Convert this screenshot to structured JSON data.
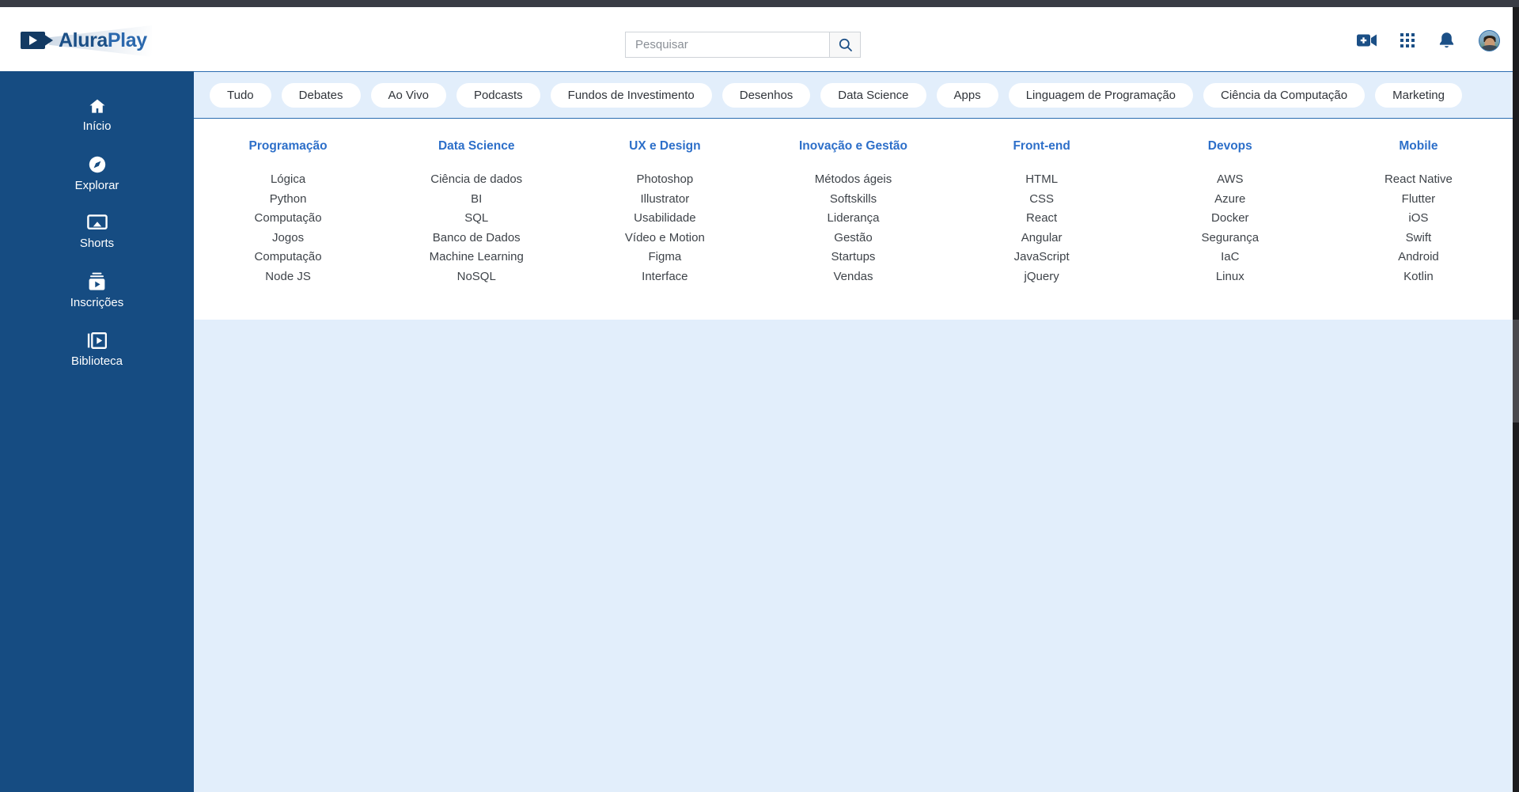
{
  "header": {
    "logo": {
      "text_primary": "Alura",
      "text_secondary": "Play",
      "icon": "video-camera-icon"
    },
    "search": {
      "placeholder": "Pesquisar",
      "value": "",
      "button_icon": "search-icon"
    },
    "actions": [
      {
        "name": "create-video-icon",
        "label": ""
      },
      {
        "name": "apps-grid-icon",
        "label": ""
      },
      {
        "name": "notifications-bell-icon",
        "label": ""
      },
      {
        "name": "user-avatar",
        "label": ""
      }
    ]
  },
  "sidebar": {
    "items": [
      {
        "label": "Início",
        "icon": "home-icon"
      },
      {
        "label": "Explorar",
        "icon": "compass-icon"
      },
      {
        "label": "Shorts",
        "icon": "shorts-screen-icon"
      },
      {
        "label": "Inscrições",
        "icon": "subscriptions-icon"
      },
      {
        "label": "Biblioteca",
        "icon": "library-icon"
      }
    ]
  },
  "chips": [
    "Tudo",
    "Debates",
    "Ao Vivo",
    "Podcasts",
    "Fundos de Investimento",
    "Desenhos",
    "Data Science",
    "Apps",
    "Linguagem de Programação",
    "Ciência da Computação",
    "Marketing"
  ],
  "categories": [
    {
      "title": "Programação",
      "links": [
        "Lógica",
        "Python",
        "Computação",
        "Jogos",
        "Computação",
        "Node JS"
      ]
    },
    {
      "title": "Data Science",
      "links": [
        "Ciência de dados",
        "BI",
        "SQL",
        "Banco de Dados",
        "Machine Learning",
        "NoSQL"
      ]
    },
    {
      "title": "UX e Design",
      "links": [
        "Photoshop",
        "Illustrator",
        "Usabilidade",
        "Vídeo e Motion",
        "Figma",
        "Interface"
      ]
    },
    {
      "title": "Inovação e Gestão",
      "links": [
        "Métodos ágeis",
        "Softskills",
        "Liderança",
        "Gestão",
        "Startups",
        "Vendas"
      ]
    },
    {
      "title": "Front-end",
      "links": [
        "HTML",
        "CSS",
        "React",
        "Angular",
        "JavaScript",
        "jQuery"
      ]
    },
    {
      "title": "Devops",
      "links": [
        "AWS",
        "Azure",
        "Docker",
        "Segurança",
        "IaC",
        "Linux"
      ]
    },
    {
      "title": "Mobile",
      "links": [
        "React Native",
        "Flutter",
        "iOS",
        "Swift",
        "Android",
        "Kotlin"
      ]
    }
  ],
  "colors": {
    "sidebar_blue": "#164c82",
    "content_blue": "#e2eefb",
    "accent_link": "#2d6fc9",
    "brand_dark": "#133a63",
    "chip_bg": "#ffffff",
    "divider": "#2b6cb0"
  }
}
